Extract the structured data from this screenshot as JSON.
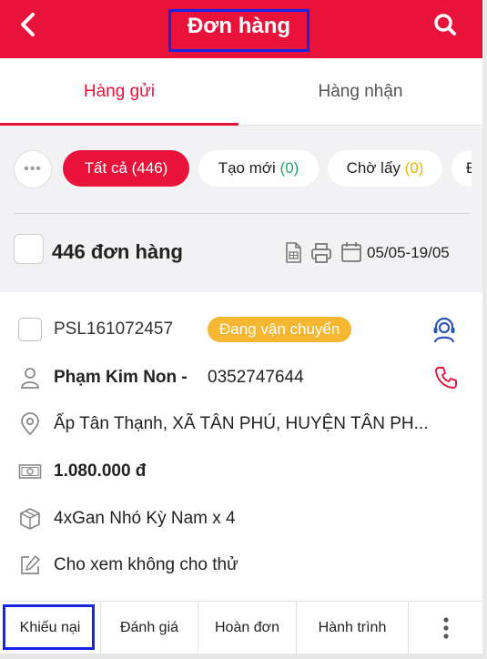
{
  "header": {
    "title": "Đơn hàng",
    "back_icon": "chevron-left-icon",
    "search_icon": "search-icon",
    "background_color": "#e8123a"
  },
  "tabs": [
    {
      "label": "Hàng gửi",
      "active": true
    },
    {
      "label": "Hàng nhận",
      "active": false
    }
  ],
  "filters": {
    "more_label": "•••",
    "chips": [
      {
        "label": "Tất cả",
        "count": "(446)",
        "active": true
      },
      {
        "label": "Tạo mới",
        "count": "(0)",
        "count_color": "#21a36a"
      },
      {
        "label": "Chờ lấy",
        "count": "(0)",
        "count_color": "#e8b800"
      },
      {
        "label": "Đ"
      }
    ]
  },
  "summary": {
    "order_count": "446 đơn hàng",
    "date_range": "05/05-19/05"
  },
  "order": {
    "code": "PSL161072457",
    "status": "Đang vận chuyển",
    "status_color": "#f5b731",
    "customer_name": "Phạm Kim Non -",
    "phone": "0352747644",
    "address": "Ấp Tân Thạnh, XÃ TÂN PHÚ, HUYỆN TÂN PH...",
    "amount": "1.080.000 đ",
    "product": "4xGan Nhó Kỳ Nam x 4",
    "note": "Cho xem không cho thử"
  },
  "actions": {
    "complaint": "Khiếu nại",
    "rate": "Đánh giá",
    "return": "Hoàn đơn",
    "journey": "Hành trình",
    "more_icon": "more-vertical-icon"
  }
}
